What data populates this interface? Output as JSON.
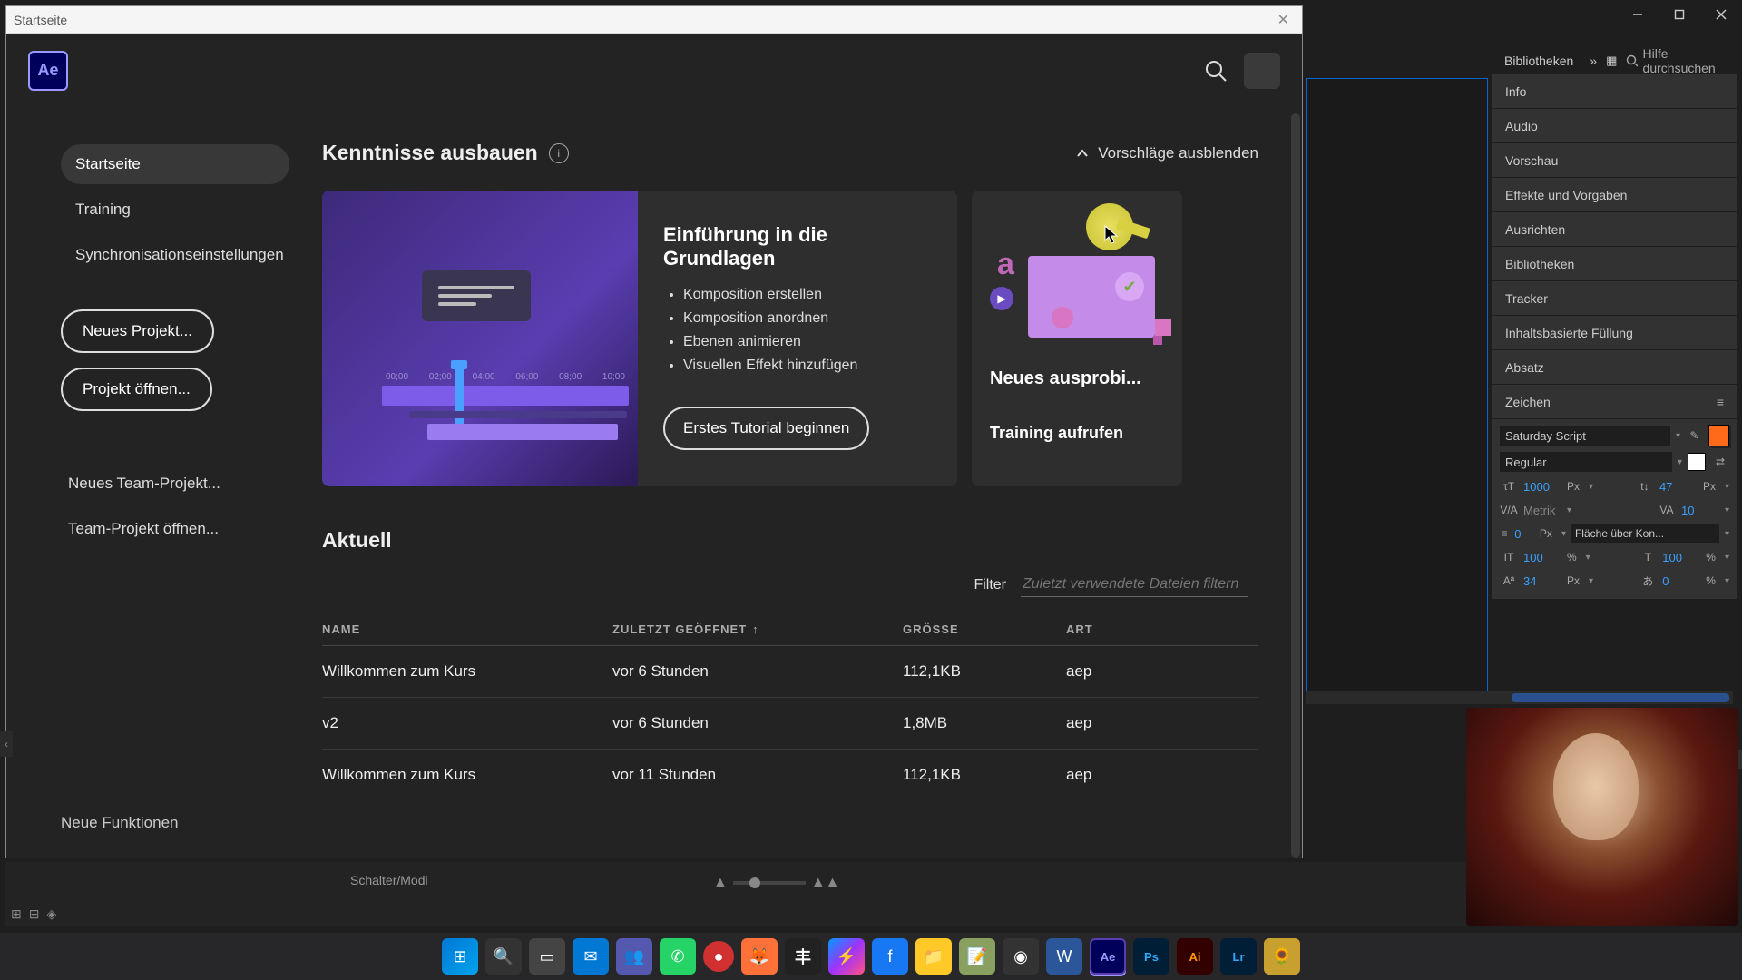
{
  "window": {
    "title": "Startseite"
  },
  "header": {
    "logo_text": "Ae"
  },
  "sidebar": {
    "nav": [
      {
        "label": "Startseite",
        "active": true
      },
      {
        "label": "Training",
        "active": false
      },
      {
        "label": "Synchronisationseinstellungen",
        "active": false
      }
    ],
    "new_project": "Neues Projekt...",
    "open_project": "Projekt öffnen...",
    "new_team": "Neues Team-Projekt...",
    "open_team": "Team-Projekt öffnen...",
    "new_features": "Neue Funktionen"
  },
  "learn": {
    "section_title": "Kenntnisse ausbauen",
    "hide_suggestions": "Vorschläge ausblenden",
    "tutorial": {
      "title": "Einführung in die Grundlagen",
      "bullets": [
        "Komposition erstellen",
        "Komposition anordnen",
        "Ebenen animieren",
        "Visuellen Effekt hinzufügen"
      ],
      "ticks": [
        "00;00",
        "02;00",
        "04;00",
        "06;00",
        "08;00",
        "10;00"
      ],
      "button": "Erstes Tutorial beginnen"
    },
    "try": {
      "title": "Neues ausprobi...",
      "link": "Training aufrufen"
    }
  },
  "recent": {
    "heading": "Aktuell",
    "filter_label": "Filter",
    "filter_placeholder": "Zuletzt verwendete Dateien filtern",
    "columns": {
      "name": "NAME",
      "opened": "ZULETZT GEÖFFNET",
      "size": "GRÖSSE",
      "kind": "ART"
    },
    "rows": [
      {
        "name": "Willkommen zum Kurs",
        "opened": "vor 6 Stunden",
        "size": "112,1KB",
        "kind": "aep"
      },
      {
        "name": "v2",
        "opened": "vor 6 Stunden",
        "size": "1,8MB",
        "kind": "aep"
      },
      {
        "name": "Willkommen zum Kurs",
        "opened": "vor 11 Stunden",
        "size": "112,1KB",
        "kind": "aep"
      }
    ]
  },
  "panels": {
    "libraries_tab": "Bibliotheken",
    "help_placeholder": "Hilfe durchsuchen",
    "stack": [
      "Info",
      "Audio",
      "Vorschau",
      "Effekte und Vorgaben",
      "Ausrichten",
      "Bibliotheken",
      "Tracker",
      "Inhaltsbasierte Füllung",
      "Absatz"
    ],
    "zeichen": {
      "title": "Zeichen",
      "font": "Saturday Script",
      "style": "Regular",
      "size": "1000",
      "size_unit": "Px",
      "leading": "47",
      "leading_unit": "Px",
      "kerning": "Metrik",
      "tracking": "10",
      "stroke": "0",
      "stroke_unit": "Px",
      "stroke_mode": "Fläche über Kon...",
      "hscale": "100",
      "hscale_unit": "%",
      "vscale": "100",
      "vscale_unit": "%",
      "baseline": "34",
      "baseline_unit": "Px",
      "tsume": "0",
      "tsume_unit": "%",
      "fill_color": "#ff6a1a"
    }
  },
  "timeline": {
    "mode_label": "Schalter/Modi"
  },
  "taskbar": {
    "items": [
      "windows",
      "search",
      "taskview",
      "mail",
      "teams",
      "whatsapp",
      "record",
      "firefox",
      "k-app",
      "messenger",
      "facebook",
      "explorer",
      "notes",
      "obs",
      "word",
      "after-effects",
      "photoshop",
      "illustrator",
      "lightroom",
      "misc"
    ]
  }
}
